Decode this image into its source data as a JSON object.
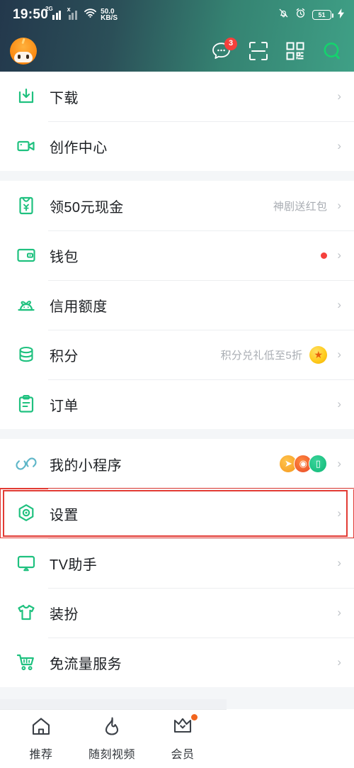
{
  "status_bar": {
    "time": "19:50",
    "sim1_tag": "2G",
    "sim2_tag": "x",
    "net_speed_value": "50.0",
    "net_speed_unit": "KB/S",
    "mute_icon": "bell-muted-icon",
    "alarm_icon": "alarm-clock-icon",
    "battery_level": "51",
    "charging_icon": "lightning-bolt-icon"
  },
  "app_bar": {
    "avatar_name": "user-avatar",
    "message_icon": "message-bubble-icon",
    "message_badge": "3",
    "scan_icon": "scan-frame-icon",
    "qr_icon": "qr-code-icon",
    "search_icon": "search-icon"
  },
  "colors": {
    "header_start": "#23384c",
    "header_end": "#3fa086",
    "accent_green": "#1fc17f",
    "badge_red": "#f5403c",
    "highlight_red": "#e23b34",
    "page_bg": "#f4f6f8"
  },
  "sections": [
    {
      "rows": [
        {
          "icon": "download-icon",
          "label": "下载",
          "hint": "",
          "badge": "",
          "highlight": false
        },
        {
          "icon": "video-camera-icon",
          "label": "创作中心",
          "hint": "",
          "badge": "",
          "highlight": false
        }
      ]
    },
    {
      "rows": [
        {
          "icon": "red-envelope-icon",
          "label": "领50元现金",
          "hint": "神剧送红包",
          "badge": "",
          "highlight": false
        },
        {
          "icon": "wallet-icon",
          "label": "钱包",
          "hint": "",
          "badge": "red-dot",
          "highlight": false
        },
        {
          "icon": "credit-sprout-icon",
          "label": "信用额度",
          "hint": "",
          "badge": "",
          "highlight": false
        },
        {
          "icon": "coins-icon",
          "label": "积分",
          "hint": "积分兑礼低至5折",
          "badge": "gold-star",
          "highlight": false
        },
        {
          "icon": "clipboard-icon",
          "label": "订单",
          "hint": "",
          "badge": "",
          "highlight": false
        }
      ]
    },
    {
      "rows": [
        {
          "icon": "link-icon",
          "label": "我的小程序",
          "hint": "",
          "badge": "mini-apps",
          "highlight": false
        },
        {
          "icon": "settings-gear-icon",
          "label": "设置",
          "hint": "",
          "badge": "",
          "highlight": true
        },
        {
          "icon": "tv-icon",
          "label": "TV助手",
          "hint": "",
          "badge": "",
          "highlight": false
        },
        {
          "icon": "tshirt-icon",
          "label": "装扮",
          "hint": "",
          "badge": "",
          "highlight": false
        },
        {
          "icon": "shopping-cart-icon",
          "label": "免流量服务",
          "hint": "",
          "badge": "",
          "highlight": false
        }
      ]
    }
  ],
  "chevron": "›",
  "bottom_nav": [
    {
      "icon": "home-icon",
      "label": "推荐",
      "dot": false
    },
    {
      "icon": "flame-icon",
      "label": "随刻视频",
      "dot": false
    },
    {
      "icon": "crown-icon",
      "label": "会员",
      "dot": true
    }
  ]
}
